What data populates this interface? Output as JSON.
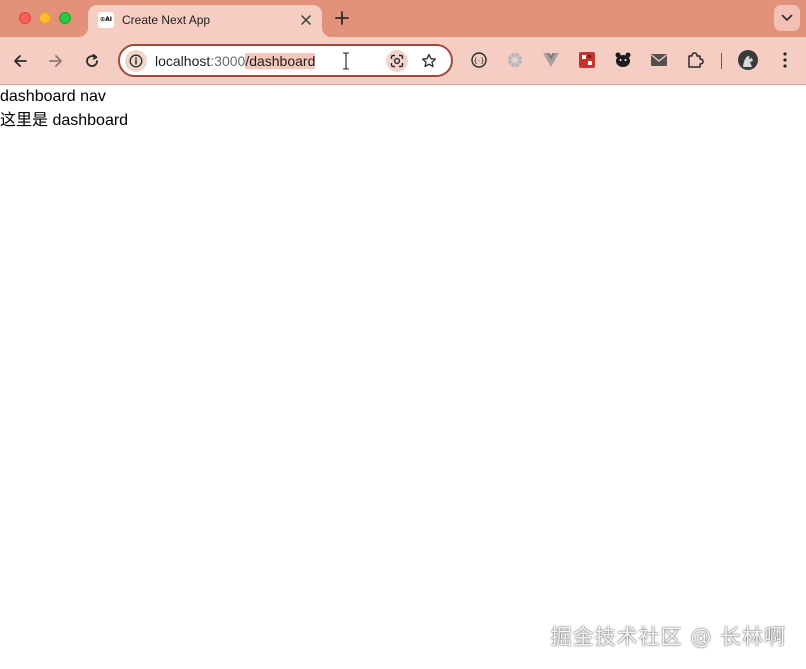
{
  "window": {
    "controls": [
      "close",
      "minimize",
      "maximize"
    ]
  },
  "tab": {
    "favicon_text": "⊙AI",
    "title": "Create Next App",
    "close_icon": "close-icon"
  },
  "newtab_icon": "plus-icon",
  "tabsearch_icon": "chevron-down-icon",
  "toolbar": {
    "back_icon": "arrow-left-icon",
    "forward_icon": "arrow-right-icon",
    "reload_icon": "reload-icon"
  },
  "address": {
    "host": "localhost",
    "port": ":3000",
    "path": "/dashboard",
    "site_info_icon": "info-icon",
    "lens_icon": "google-lens-icon",
    "bookmark_icon": "star-icon"
  },
  "extensions": [
    "devtools-extension-icon",
    "gray-gear-extension-icon",
    "vue-extension-icon",
    "red-extension-icon",
    "bear-extension-icon",
    "mail-extension-icon",
    "puzzle-extensions-icon"
  ],
  "profile_icon": "profile-avatar",
  "menu_icon": "kebab-menu-icon",
  "page": {
    "nav_text": "dashboard nav",
    "body_text": "这里是 dashboard"
  },
  "watermark": "掘金技术社区 @ 长林啊",
  "colors": {
    "tabstrip": "#e3917a",
    "toolbar": "#f6cdc2",
    "omnibox_border": "#9e4a3a"
  }
}
